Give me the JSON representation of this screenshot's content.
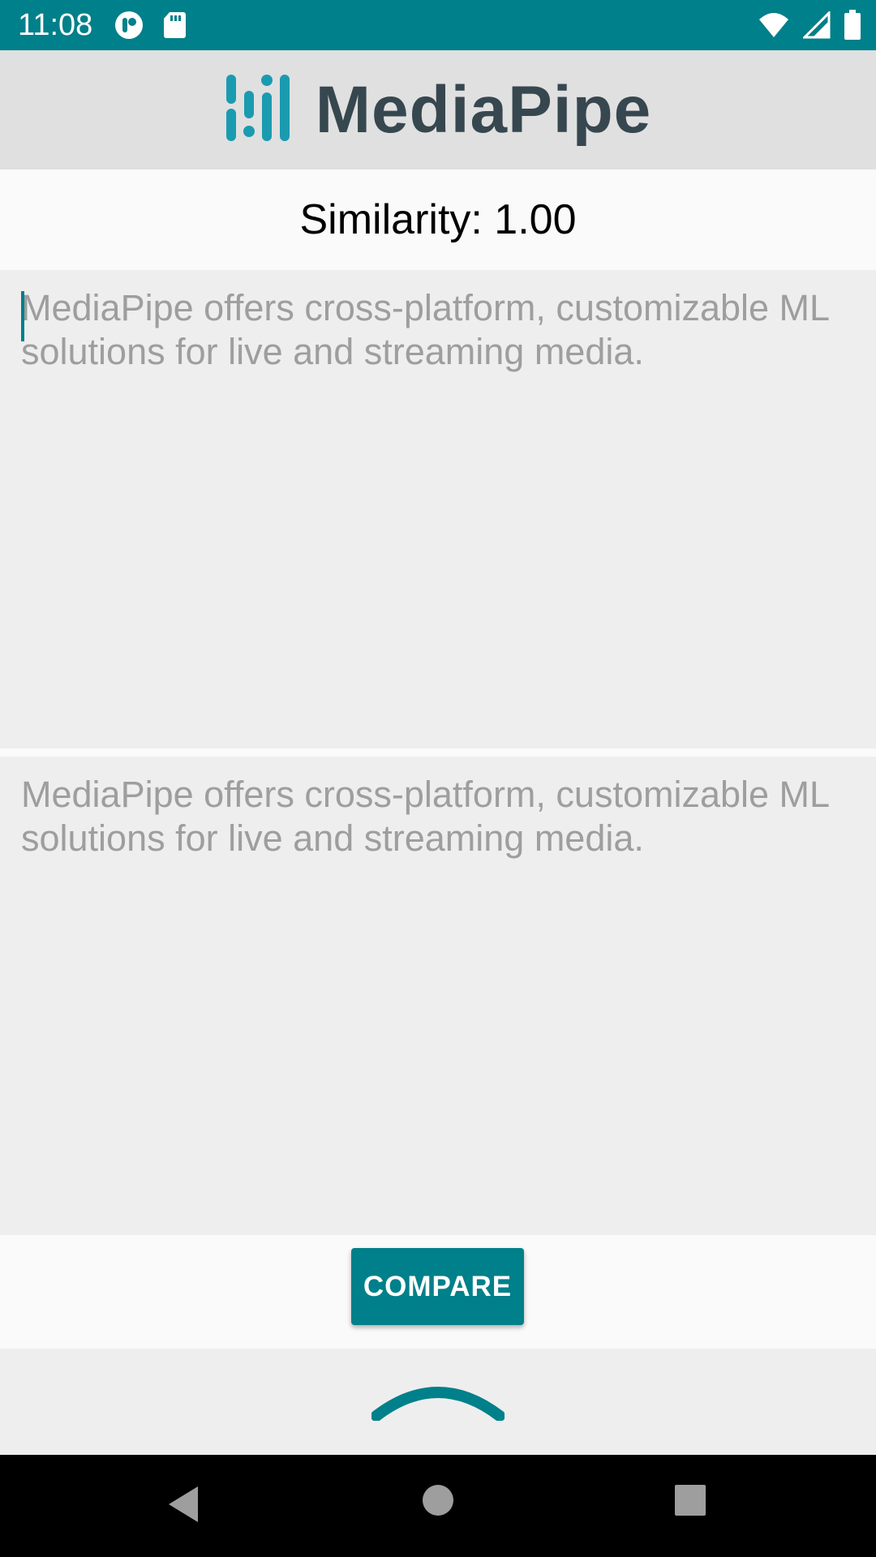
{
  "status_bar": {
    "time": "11:08",
    "left_icons": [
      "notification-app-icon",
      "sd-card-icon"
    ],
    "right_icons": [
      "wifi-icon",
      "signal-icon",
      "battery-icon"
    ],
    "background_color": "#00808a"
  },
  "app_bar": {
    "logo_text": "MediaPipe",
    "logo_icon": "mediapipe-logo-icon",
    "logo_color": "#1a9bb0"
  },
  "result": {
    "similarity_text": "Similarity: 1.00"
  },
  "inputs": {
    "first_placeholder": "MediaPipe offers cross-platform, customizable ML solutions for live and streaming media.",
    "second_placeholder": "MediaPipe offers cross-platform, customizable ML solutions for live and streaming media."
  },
  "actions": {
    "compare_label": "COMPARE"
  },
  "bottom_sheet": {
    "handle_icon": "chevron-up-icon"
  },
  "nav_bar": {
    "buttons": [
      "back-icon",
      "home-icon",
      "recents-icon"
    ]
  },
  "colors": {
    "accent": "#00808a",
    "text_hint": "#9e9e9e",
    "input_background": "#eeeeee"
  }
}
